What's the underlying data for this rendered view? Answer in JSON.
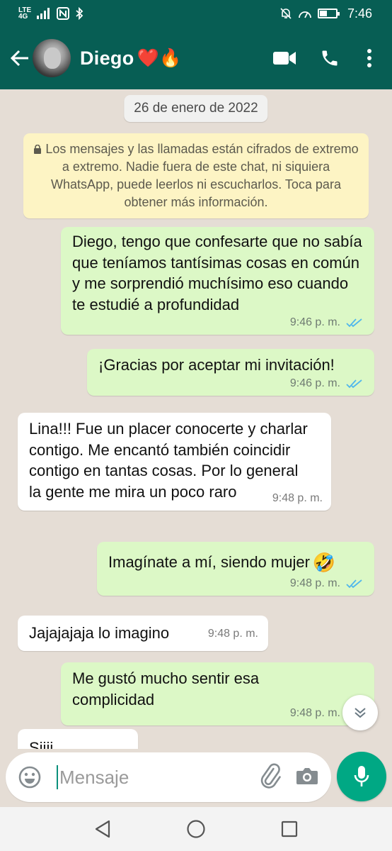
{
  "status_bar": {
    "network": "LTE",
    "network_sub": "4G",
    "time": "7:46"
  },
  "header": {
    "contact_name": "Diego",
    "name_emojis": "❤️🔥"
  },
  "chat": {
    "date_chip": "26 de enero de 2022",
    "encryption_notice": "Los mensajes y las llamadas están cifrados de extremo a extremo. Nadie fuera de este chat, ni siquiera WhatsApp, puede leerlos ni escucharlos. Toca para obtener más información.",
    "messages": [
      {
        "direction": "out",
        "text": "Diego, tengo que confesarte que no sabía que teníamos tantísimas cosas en común y me sorprendió muchísimo eso cuando te estudié a profundidad",
        "time": "9:46 p. m.",
        "status": "read"
      },
      {
        "direction": "out",
        "text": "¡Gracias por aceptar mi invitación!",
        "time": "9:46 p. m.",
        "status": "read"
      },
      {
        "direction": "in",
        "text": "Lina!!! Fue un placer conocerte y charlar contigo. Me encantó también coincidir contigo en tantas cosas. Por lo general la gente me mira un poco raro",
        "time": "9:48 p. m."
      },
      {
        "direction": "out",
        "text": "Imagínate a mí, siendo mujer",
        "emoji": "🤣",
        "time": "9:48 p. m.",
        "status": "read"
      },
      {
        "direction": "in",
        "text": "Jajajajaja lo imagino",
        "time": "9:48 p. m."
      },
      {
        "direction": "out",
        "text": "Me gustó mucho sentir esa complicidad",
        "time": "9:48 p. m.",
        "status": "read"
      },
      {
        "direction": "in",
        "text": "Siiii"
      }
    ]
  },
  "composer": {
    "placeholder": "Mensaje"
  },
  "colors": {
    "header": "#075e54",
    "chat_background": "#e5ddd5",
    "outgoing_bubble": "#dcf8c6",
    "incoming_bubble": "#ffffff",
    "read_ticks": "#4fb6ec",
    "mic_button": "#00a884"
  },
  "icons": {
    "back": "arrow-left-icon",
    "video": "video-camera-icon",
    "call": "phone-icon",
    "menu": "more-vert-icon",
    "lock": "lock-icon",
    "emoji": "emoji-smile-icon",
    "attach": "paperclip-icon",
    "camera": "camera-icon",
    "mic": "microphone-icon",
    "scroll": "double-chevron-down-icon"
  }
}
